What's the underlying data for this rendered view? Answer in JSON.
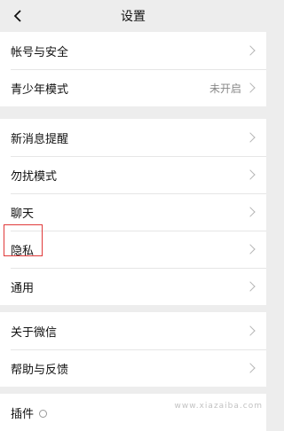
{
  "header": {
    "title": "设置"
  },
  "groups": [
    {
      "items": [
        {
          "label": "帐号与安全"
        },
        {
          "label": "青少年模式",
          "value": "未开启"
        }
      ]
    },
    {
      "items": [
        {
          "label": "新消息提醒"
        },
        {
          "label": "勿扰模式"
        },
        {
          "label": "聊天"
        },
        {
          "label": "隐私"
        },
        {
          "label": "通用"
        }
      ]
    },
    {
      "items": [
        {
          "label": "关于微信"
        },
        {
          "label": "帮助与反馈"
        }
      ]
    },
    {
      "items": [
        {
          "label": "插件"
        }
      ]
    }
  ],
  "watermark": "www.xiazaiba.com",
  "colors": {
    "highlight": "#e03a3a",
    "background": "#ededed"
  }
}
